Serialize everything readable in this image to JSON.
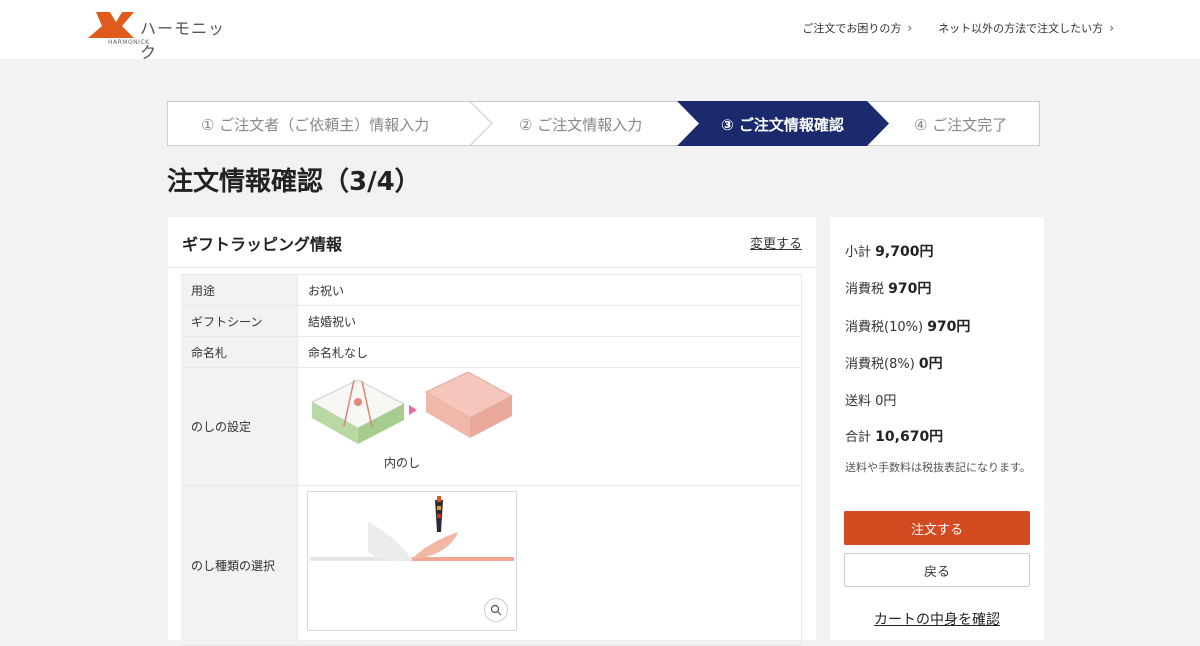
{
  "header": {
    "logo_text": "ハーモニック",
    "logo_sub": "HARMONICK",
    "links": [
      {
        "label": "ご注文でお困りの方"
      },
      {
        "label": "ネット以外の方法で注文したい方"
      }
    ]
  },
  "stepper": {
    "steps": [
      {
        "label": "① ご注文者（ご依頼主）情報入力"
      },
      {
        "label": "② ご注文情報入力"
      },
      {
        "label": "③ ご注文情報確認"
      },
      {
        "label": "④ ご注文完了"
      }
    ],
    "active_color": "#1a2a6c"
  },
  "page_title": "注文情報確認（3/4）",
  "gift": {
    "title": "ギフトラッピング情報",
    "change_label": "変更する",
    "rows": [
      {
        "label": "用途",
        "value": "お祝い"
      },
      {
        "label": "ギフトシーン",
        "value": "結婚祝い"
      },
      {
        "label": "命名札",
        "value": "命名札なし"
      },
      {
        "label": "のしの設定",
        "value": "内のし"
      },
      {
        "label": "のし種類の選択",
        "value": ""
      }
    ]
  },
  "summary": {
    "subtotal_label": "小計",
    "subtotal_value": "9,700円",
    "tax_label": "消費税",
    "tax_value": "970円",
    "tax10_label": "消費税(10%)",
    "tax10_value": "970円",
    "tax8_label": "消費税(8%)",
    "tax8_value": "0円",
    "shipping_label": "送料",
    "shipping_value": "0円",
    "total_label": "合計",
    "total_value": "10,670円",
    "note": "送料や手数料は税抜表記になります。",
    "order_button": "注文する",
    "back_button": "戻る",
    "cart_link": "カートの中身を確認",
    "accent_color": "#d24a1f"
  },
  "icons": {
    "header_chevron": "chevron-right-icon",
    "zoom": "magnifier-icon",
    "arrow": "pink-arrow-icon"
  }
}
